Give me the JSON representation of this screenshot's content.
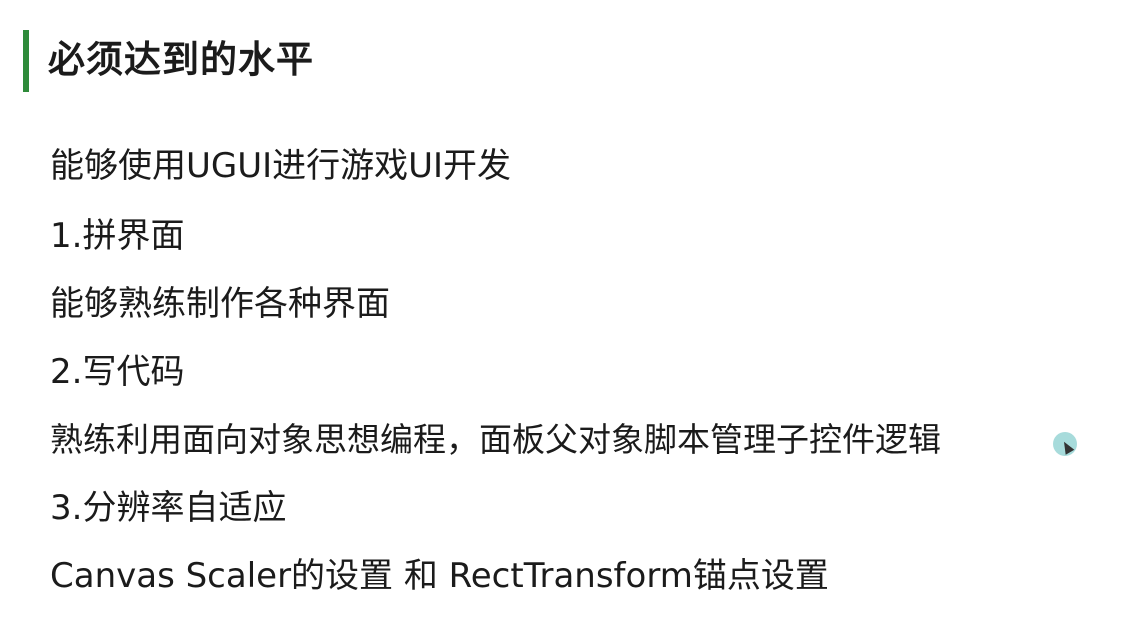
{
  "slide": {
    "title": "必须达到的水平",
    "accent_color": "#2e8b3a",
    "lines": [
      "能够使用UGUI进行游戏UI开发",
      "1.拼界面",
      "能够熟练制作各种界面",
      "2.写代码",
      "熟练利用面向对象思想编程，面板父对象脚本管理子控件逻辑",
      "3.分辨率自适应",
      "Canvas Scaler的设置 和 RectTransform锚点设置"
    ]
  },
  "cursor": {
    "icon": "cursor-highlight-icon",
    "highlight_color": "#78c8c8"
  }
}
